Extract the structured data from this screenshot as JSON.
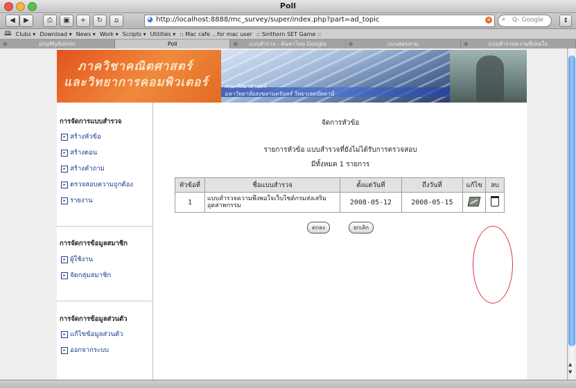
{
  "window": {
    "title": "Poll"
  },
  "toolbar": {
    "url": "http://localhost:8888/mc_survey/super/index.php?part=ad_topic",
    "search_placeholder": "Q- Google"
  },
  "bookmarks": [
    "Clubs ▾",
    "Download ▾",
    "News ▾",
    "Work ▾",
    "Scripts ▾",
    "Utilities ▾",
    ":: Mac cafe ...for mac user",
    ":: Sinthorn SET Game ::"
  ],
  "tabs": [
    {
      "label": "phpMyAdmin",
      "active": false
    },
    {
      "label": "Poll",
      "active": true
    },
    {
      "label": "แบบสำรวจ - ค้นหาโดย Google",
      "active": false
    },
    {
      "label": "แบบสอบถาม",
      "active": false
    },
    {
      "label": "แบบสำรวจความพึงพอใจ",
      "active": false
    }
  ],
  "banner": {
    "line1": "ภาควิชาคณิตศาสตร์",
    "line2": "และวิทยาการคอมพิวเตอร์",
    "sub1": "คณะวิทยาศาสตร์",
    "sub2": "มหาวิทยาลัยสงขลานครินทร์ วิทยาเขตปัตตานี"
  },
  "sidebar": {
    "sections": [
      {
        "title": "การจัดการแบบสำรวจ",
        "items": [
          "สร้างหัวข้อ",
          "สร้างตอน",
          "สร้างคำถาม",
          "ตรวจสอบความถูกต้อง",
          "รายงาน"
        ]
      },
      {
        "title": "การจัดการข้อมูลสมาชิก",
        "items": [
          "ผู้ใช้งาน",
          "จัดกลุ่มสมาชิก"
        ]
      },
      {
        "title": "การจัดการข้อมูลส่วนตัว",
        "items": [
          "แก้ไขข้อมูลส่วนตัว",
          "ออกจากระบบ"
        ]
      }
    ]
  },
  "main": {
    "title": "จัดการหัวข้อ",
    "list_title": "รายการหัวข้อ แบบสำรวจที่ยังไม่ได้รับการตรวจสอบ",
    "count": "มีทั้งหมด 1 รายการ",
    "table": {
      "headers": [
        "หัวข้อที่",
        "ชื่อแบบสำรวจ",
        "ตั้งแต่วันที่",
        "ถึงวันที่",
        "แก้ไข",
        "ลบ"
      ],
      "rows": [
        {
          "no": "1",
          "name": "แบบสำรวจความพึงพอใจเว็บไซต์กรมส่งเสริมอุตสาหกรรม",
          "from": "2008-05-12",
          "to": "2008-05-15"
        }
      ]
    },
    "buttons": {
      "ok": "ตกลง",
      "cancel": "ยกเลิก"
    }
  },
  "accent": {
    "highlight_circle": "#d9333b",
    "banner_orange": "#e2531d"
  }
}
